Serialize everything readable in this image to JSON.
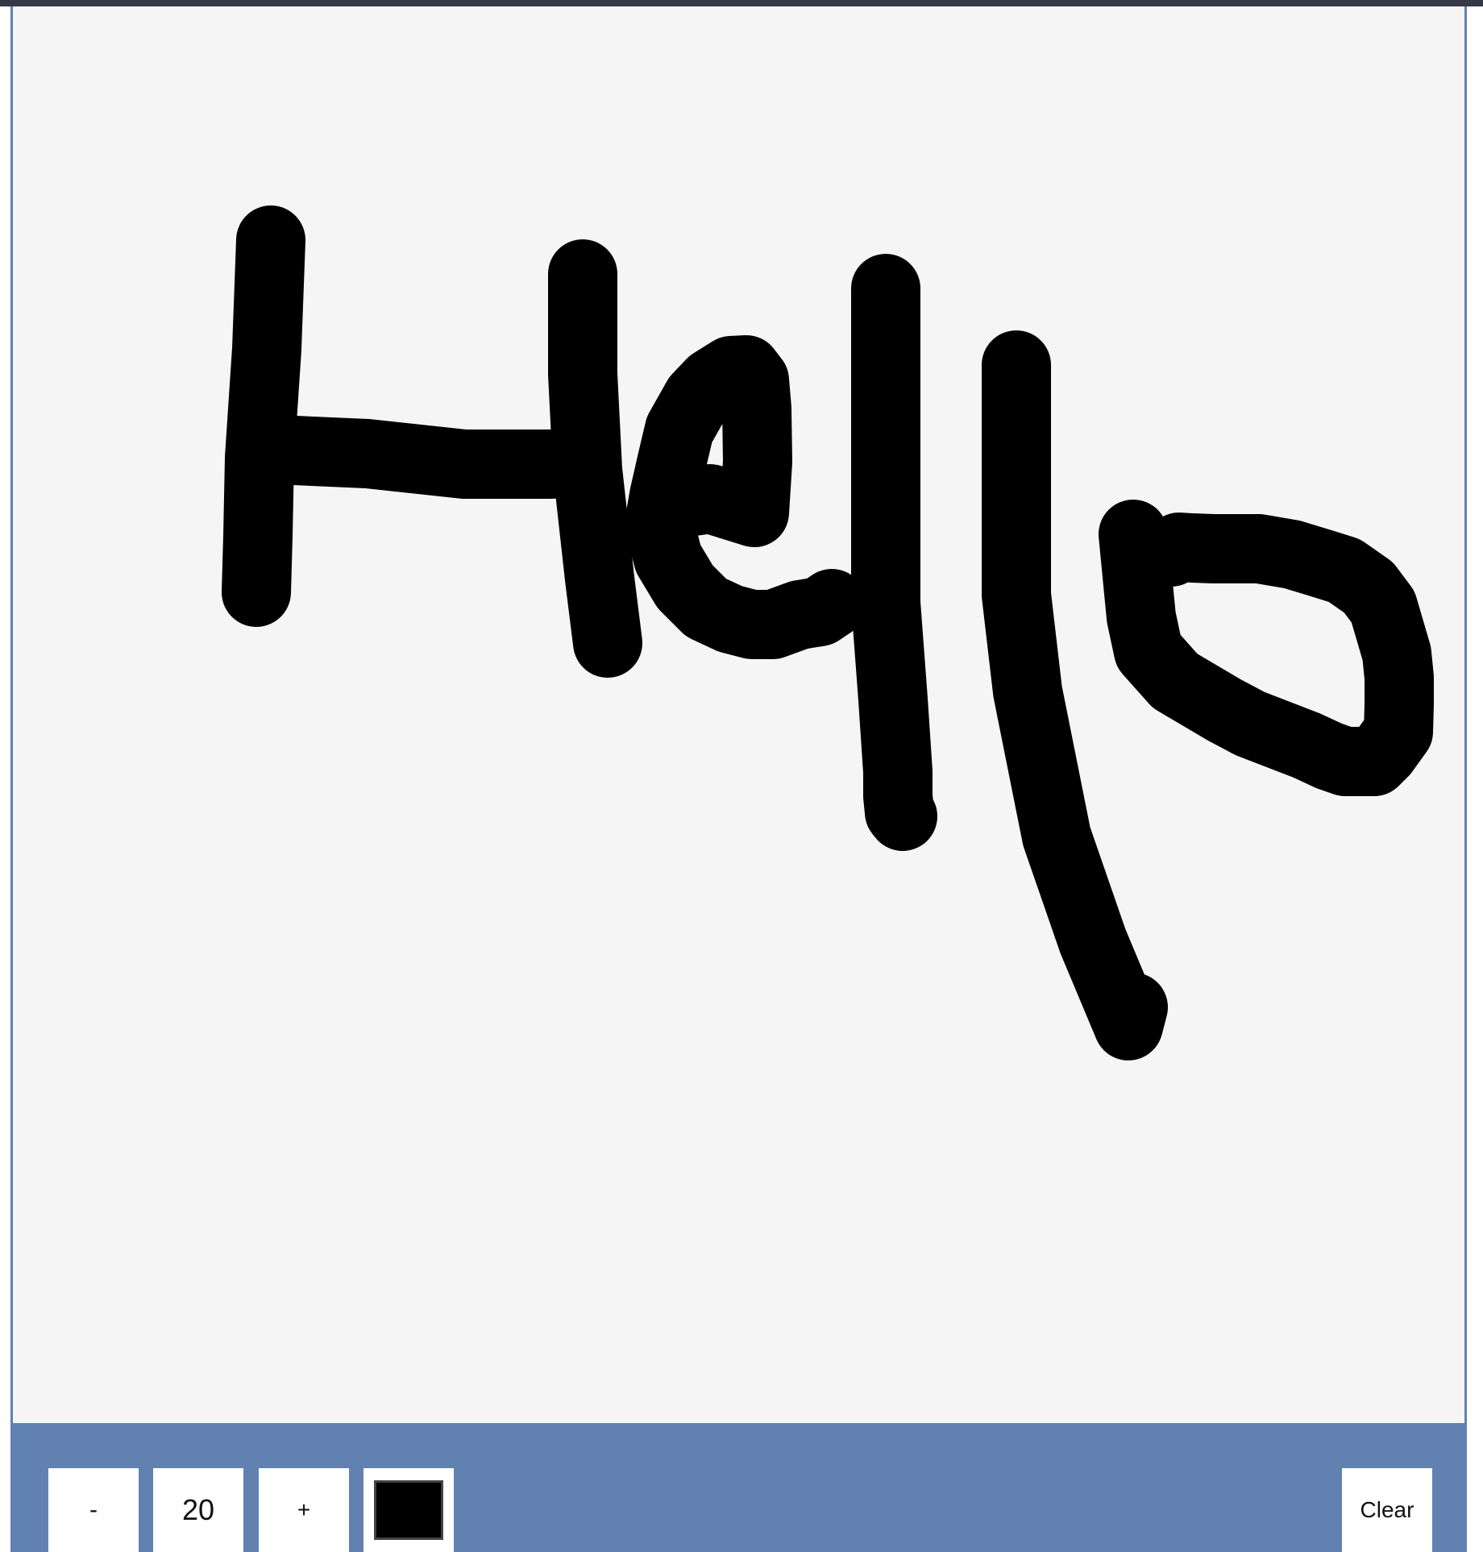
{
  "toolbar": {
    "decrease_label": "-",
    "brush_size": "20",
    "increase_label": "+",
    "clear_label": "Clear"
  },
  "colors": {
    "brush_color": "#000000",
    "toolbar_background": "#6181b1",
    "canvas_background": "#f5f5f5"
  },
  "icons": {
    "color_picker": "color-swatch-icon"
  }
}
